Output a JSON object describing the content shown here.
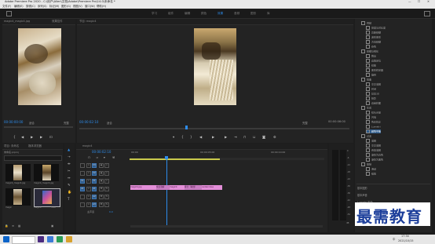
{
  "app": {
    "title": "Adobe Premiere Pro 2020 - C:\\用户\\Allen\\文档\\Adobe\\Premiere Pro\\14.0\\未命名 *",
    "window_controls": [
      "—",
      "☐",
      "✕"
    ]
  },
  "menu": [
    "文件(F)",
    "编辑(E)",
    "剪辑(C)",
    "序列(S)",
    "标记(M)",
    "图形(G)",
    "视图(V)",
    "窗口(W)",
    "帮助(H)"
  ],
  "workspaces": {
    "tabs": [
      "学习",
      "组件",
      "编辑",
      "颜色",
      "效果",
      "音频",
      "图形",
      "库"
    ],
    "active_index": 4
  },
  "source_monitor": {
    "tabs": [
      "源: (无剪辑)",
      "magic4_magic4.jpg",
      "效果控件"
    ],
    "timecode": "00:00:00:00",
    "fit": "适合",
    "quality": "完整",
    "duration": "00:00:04:29"
  },
  "program_monitor": {
    "title": "节目: magic4",
    "timecode": "00:00:02:10",
    "fit": "适合",
    "quality": "完整",
    "duration": "00:00:06:00"
  },
  "project": {
    "tabs": [
      "项目: 未命名",
      "媒体浏览器"
    ],
    "file": "未命名.prproj",
    "items": [
      {
        "name": "magic4_magic4.jpg",
        "duration": ""
      },
      {
        "name": "magic4_magic4.jpg",
        "duration": ""
      },
      {
        "name": "magic",
        "duration": ""
      },
      {
        "name": "magic4",
        "duration": "5:00"
      }
    ]
  },
  "timeline": {
    "tab": "magic4",
    "timecode": "00:00:02:10",
    "ruler": [
      "00:00",
      "00:00:05:00",
      "00:00:10:00"
    ],
    "tracks": [
      {
        "id": "V3"
      },
      {
        "id": "V2"
      },
      {
        "id": "V1"
      },
      {
        "id": "A1"
      },
      {
        "id": "A2"
      },
      {
        "id": "A3"
      }
    ],
    "master_label": "主声道",
    "master_value": "0.0",
    "clips": [
      "magic4.jpg",
      "交叉溶解",
      "magic4",
      "拆分（两线）",
      "centerclose"
    ]
  },
  "audio_meter": {
    "marks": [
      "0",
      "-6",
      "-12",
      "-18",
      "-24",
      "-30",
      "-36",
      "-42",
      "-48",
      "-54"
    ],
    "unit": "dB"
  },
  "effects": {
    "items": [
      "视频",
      "亮度与对比度",
      "高斯模糊",
      "波形变形",
      "方向模糊",
      "杂色",
      "模糊与锐化",
      "裁剪",
      "边角定位",
      "镜像",
      "变形稳定器",
      "旋转",
      "扭曲",
      "交叉溶解",
      "时间",
      "基本3D",
      "投影",
      "边缘斜面",
      "生成",
      "镜头光晕",
      "闪电",
      "色彩校正",
      "Lumetri",
      "颜色平衡",
      "过渡",
      "溶解",
      "交叉溶解",
      "叠加溶解",
      "渐隐为白色",
      "渐隐为黑色",
      "擦除",
      "滑动",
      "缩放"
    ],
    "sections": [
      "基本图形",
      "基本声音",
      "Lumetri 颜色"
    ]
  },
  "watermark": "最需教育",
  "taskbar": {
    "time": "17:34",
    "date": "2021/10/15",
    "lang": "中"
  }
}
